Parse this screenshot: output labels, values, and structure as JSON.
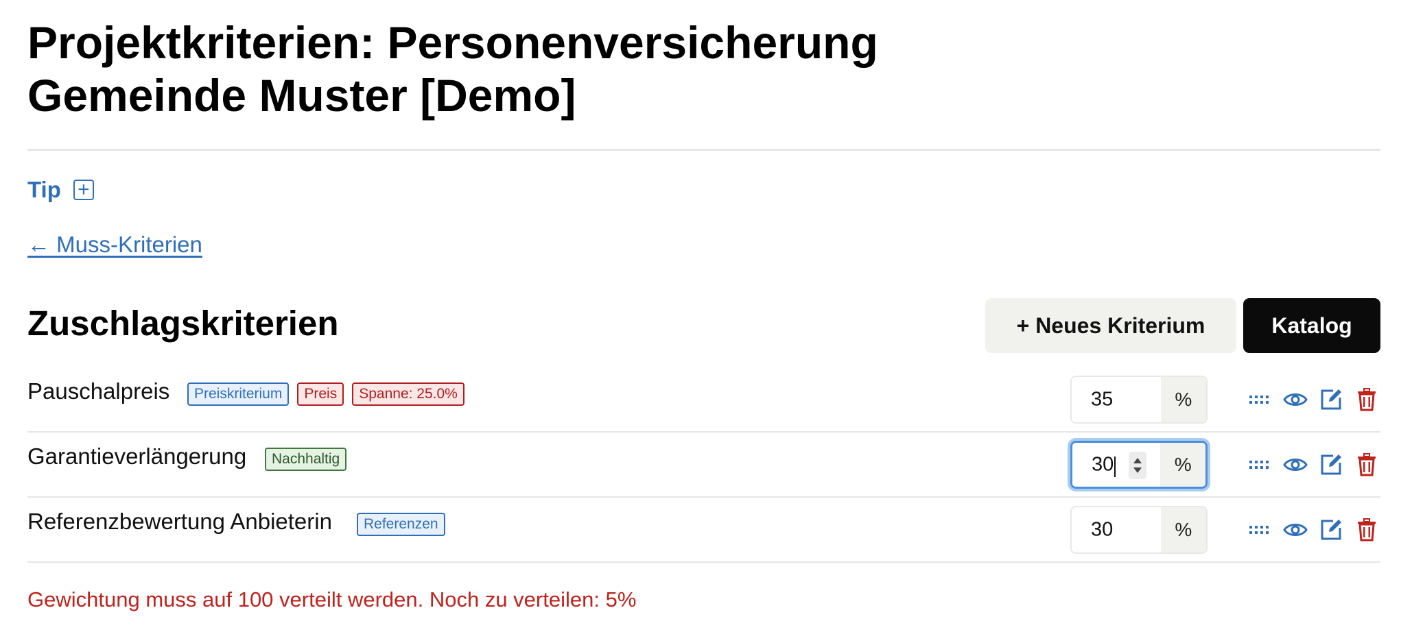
{
  "page": {
    "title_line1": "Projektkriterien: Personenversicherung",
    "title_line2": "Gemeinde Muster [Demo]"
  },
  "tip": {
    "label": "Tip",
    "toggle_symbol": "+"
  },
  "back_link": {
    "label": "← Muss-Kriterien"
  },
  "section": {
    "title": "Zuschlagskriterien",
    "new_button": "+ Neues Kriterium",
    "catalog_button": "Katalog"
  },
  "criteria": [
    {
      "name": "Pauschalpreis",
      "tags": [
        {
          "label": "Preiskriterium",
          "color": "blue"
        },
        {
          "label": "Preis",
          "color": "red"
        },
        {
          "label": "Spanne: 25.0%",
          "color": "red"
        }
      ],
      "weight": "35",
      "unit": "%",
      "focused": false
    },
    {
      "name": "Garantieverlängerung",
      "tags": [
        {
          "label": "Nachhaltig",
          "color": "green"
        }
      ],
      "weight": "30",
      "unit": "%",
      "focused": true
    },
    {
      "name": "Referenzbewertung Anbieterin",
      "tags": [
        {
          "label": "Referenzen",
          "color": "blue"
        }
      ],
      "weight": "30",
      "unit": "%",
      "focused": false
    }
  ],
  "row_actions": {
    "icons": [
      "drag-handle-icon",
      "eye-icon",
      "edit-icon",
      "trash-icon"
    ]
  },
  "warning": "Gewichtung muss auf 100 verteilt werden. Noch zu verteilen: 5%",
  "colors": {
    "link": "#2f6fba",
    "danger": "#c0221c",
    "catalog_bg": "#0b0b0b",
    "focus": "#4a90d9"
  }
}
